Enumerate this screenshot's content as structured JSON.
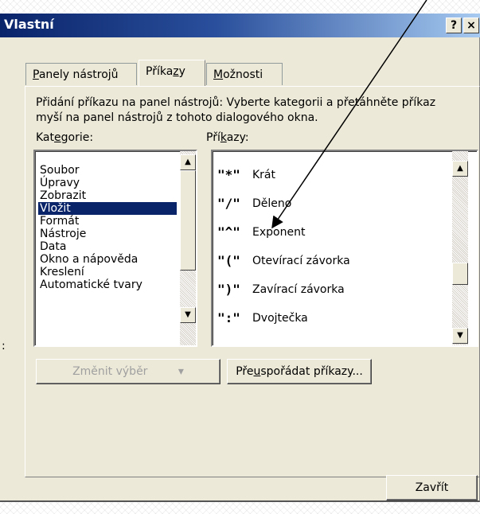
{
  "window": {
    "title": "Vlastní",
    "help_label": "?",
    "close_label": "×"
  },
  "tabs": [
    {
      "pre": "",
      "key": "P",
      "post": "anely nástrojů"
    },
    {
      "pre": "Příka",
      "key": "z",
      "post": "y"
    },
    {
      "pre": "",
      "key": "M",
      "post": "ožnosti"
    }
  ],
  "description": {
    "line1": "Přidání příkazu na panel nástrojů: Vyberte kategorii a přetáhněte příkaz",
    "line2": "myší na panel nástrojů z tohoto dialogového okna."
  },
  "categories_label": {
    "pre": "Kat",
    "key": "e",
    "post": "gorie:"
  },
  "commands_label": {
    "pre": "Pří",
    "key": "k",
    "post": "azy:"
  },
  "categories": [
    "Soubor",
    "Úpravy",
    "Zobrazit",
    "Vložit",
    "Formát",
    "Nástroje",
    "Data",
    "Okno a nápověda",
    "Kreslení",
    "Automatické tvary"
  ],
  "selected_category": "Vložit",
  "commands": [
    {
      "icon": "\"*\"",
      "label": "Krát"
    },
    {
      "icon": "\"/\"",
      "label": "Děleno"
    },
    {
      "icon": "\"^\"",
      "label": "Exponent"
    },
    {
      "icon": "\"(\"",
      "label": "Otevírací závorka"
    },
    {
      "icon": "\")\"",
      "label": "Zavírací závorka"
    },
    {
      "icon": "\":\"",
      "label": "Dvojtečka"
    }
  ],
  "buttons": {
    "modify_selection": "Změnit výběr",
    "modify_arrow": "▾",
    "rearrange": {
      "pre": "Pře",
      "key": "u",
      "post": "spořádat příkazy..."
    },
    "close": "Zavřít"
  },
  "scroll_up": "▲",
  "scroll_down": "▼",
  "side_mark": ":"
}
